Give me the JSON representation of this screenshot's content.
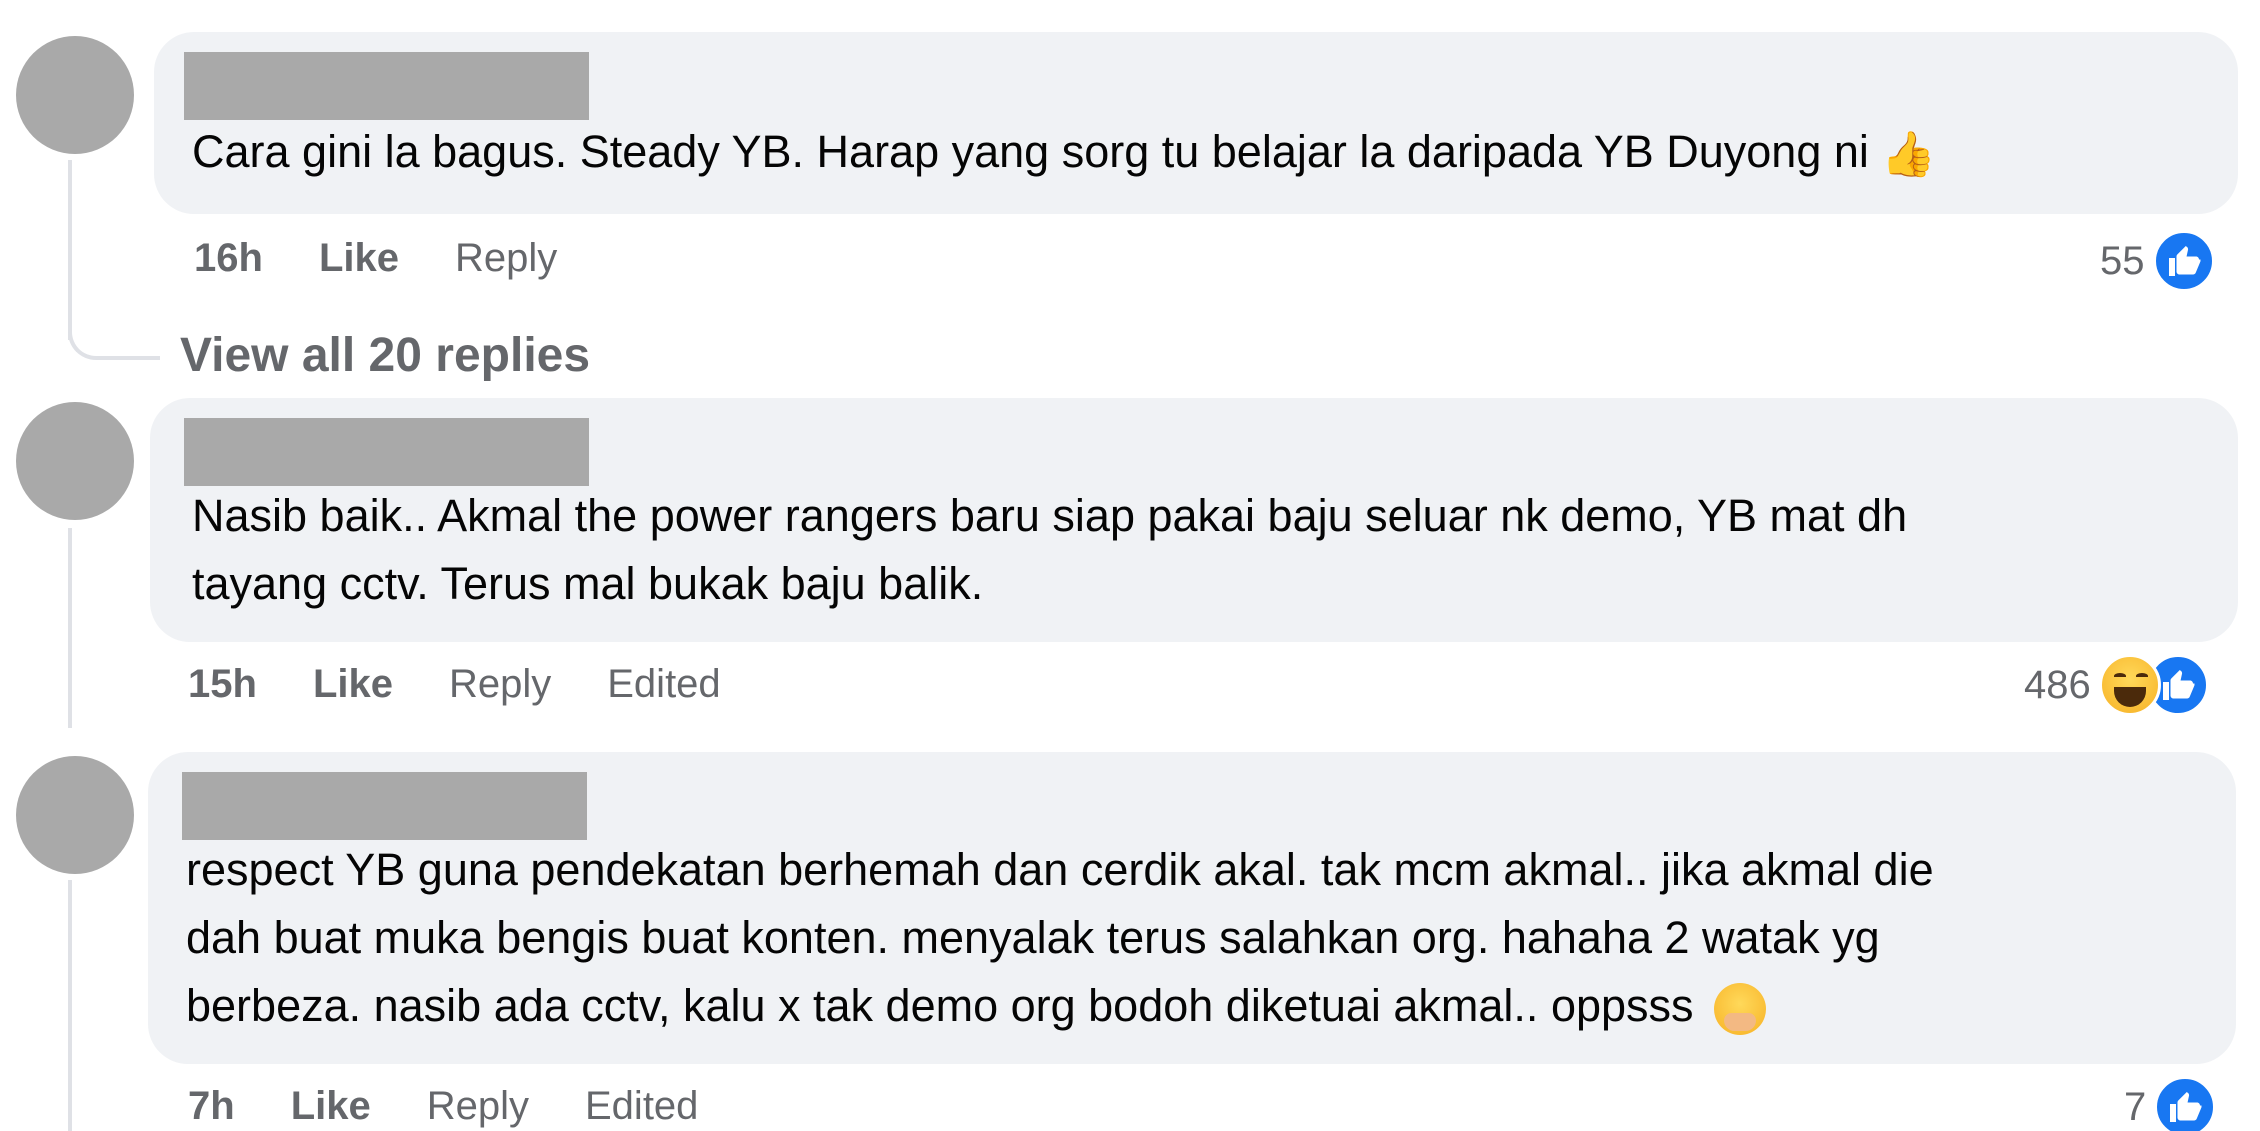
{
  "comments": [
    {
      "text_lines": [
        "Cara gini la bagus. Steady YB. Harap yang sorg tu belajar la daripada YB Duyong ni"
      ],
      "trailing_emoji": "thumbs-up",
      "time": "16h",
      "like_label": "Like",
      "reply_label": "Reply",
      "edited_label": "",
      "reaction_count": "55",
      "reactions": [
        "like"
      ]
    },
    {
      "text_lines": [
        "Nasib baik.. Akmal the power rangers baru siap pakai baju seluar nk demo, YB mat dh",
        "tayang cctv. Terus mal bukak baju balik."
      ],
      "time": "15h",
      "like_label": "Like",
      "reply_label": "Reply",
      "edited_label": "Edited",
      "reaction_count": "486",
      "reactions": [
        "haha",
        "like"
      ]
    },
    {
      "text_lines": [
        "respect YB guna pendekatan berhemah dan cerdik akal. tak mcm akmal.. jika akmal die",
        "dah buat muka bengis buat konten. menyalak terus salahkan org. hahaha 2 watak yg",
        "berbeza. nasib ada cctv, kalu x tak demo org bodoh diketuai akmal.. oppsss"
      ],
      "trailing_emoji": "hand-over-mouth",
      "time": "7h",
      "like_label": "Like",
      "reply_label": "Reply",
      "edited_label": "Edited",
      "reaction_count": "7",
      "reactions": [
        "like"
      ]
    }
  ],
  "view_replies_label": "View all 20 replies",
  "colors": {
    "bubble": "#f0f2f5",
    "meta_text": "#65676b",
    "like_blue": "#1877f2",
    "avatar_redacted": "#a9a9a9"
  }
}
